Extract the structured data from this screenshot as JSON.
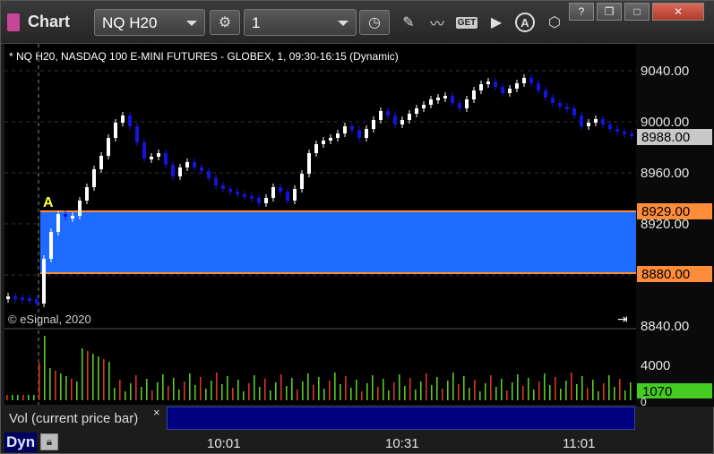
{
  "toolbar": {
    "title": "Chart",
    "symbol": "NQ H20",
    "interval": "1"
  },
  "window_buttons": [
    "?",
    "❐",
    "□",
    "✕"
  ],
  "chart": {
    "info": "* NQ H20, NASDAQ 100 E-MINI FUTURES - GLOBEX, 1, 09:30-16:15 (Dynamic)",
    "copyright": "© eSignal, 2020",
    "marker": "A",
    "price_ticks": [
      "9040.00",
      "9000.00",
      "8960.00",
      "8920.00",
      "8840.00"
    ],
    "price_last": "8988.00",
    "level_high": "8929.00",
    "level_low": "8880.00",
    "vol_tick": "4000",
    "vol_last": "1070",
    "vol_zero": "0",
    "time_ticks": [
      "10:01",
      "10:31",
      "11:01"
    ],
    "colors": {
      "up": "#ffffff",
      "down": "#1414e0",
      "band": "#1e6bff",
      "level": "#ff8c3a",
      "last": "#c8c8c8",
      "vol_last": "#44cc22"
    }
  },
  "vol_panel": {
    "label": "Vol (current price bar)",
    "close": "×"
  },
  "status": {
    "dyn": "Dyn"
  }
}
